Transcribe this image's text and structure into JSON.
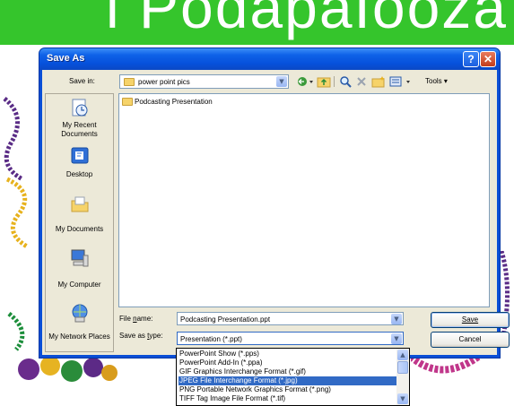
{
  "slide": {
    "banner_text": "i PodapaIooza"
  },
  "dialog": {
    "title": "Save As",
    "help_glyph": "?",
    "close_glyph": "✕"
  },
  "toolbar": {
    "save_in_label": "Save in:",
    "save_in_value": "power point pics",
    "tools_label": "Tools",
    "icons": [
      "back-icon",
      "up-folder-icon",
      "search-web-icon",
      "delete-icon",
      "new-folder-icon",
      "views-icon"
    ]
  },
  "places": [
    {
      "label": "My Recent Documents"
    },
    {
      "label": "Desktop"
    },
    {
      "label": "My Documents"
    },
    {
      "label": "My Computer"
    },
    {
      "label": "My Network Places"
    }
  ],
  "files": [
    {
      "name": "Podcasting Presentation",
      "type": "folder"
    }
  ],
  "bottom": {
    "file_name_label": "File name:",
    "file_name_value": "Podcasting Presentation.ppt",
    "save_type_label": "Save as type:",
    "save_type_value": "Presentation (*.ppt)",
    "save_button": "Save",
    "cancel_button": "Cancel"
  },
  "type_options": [
    {
      "label": "PowerPoint Show (*.pps)",
      "selected": false
    },
    {
      "label": "PowerPoint Add-In (*.ppa)",
      "selected": false
    },
    {
      "label": "GIF Graphics Interchange Format (*.gif)",
      "selected": false
    },
    {
      "label": "JPEG File Interchange Format (*.jpg)",
      "selected": true
    },
    {
      "label": "PNG Portable Network Graphics Format (*.png)",
      "selected": false
    },
    {
      "label": "TIFF Tag Image File Format (*.tif)",
      "selected": false
    }
  ],
  "colors": {
    "titlebar": "#0651dc",
    "dialog_bg": "#ece9d8",
    "banner": "#35c52c",
    "selection": "#316ac5"
  }
}
